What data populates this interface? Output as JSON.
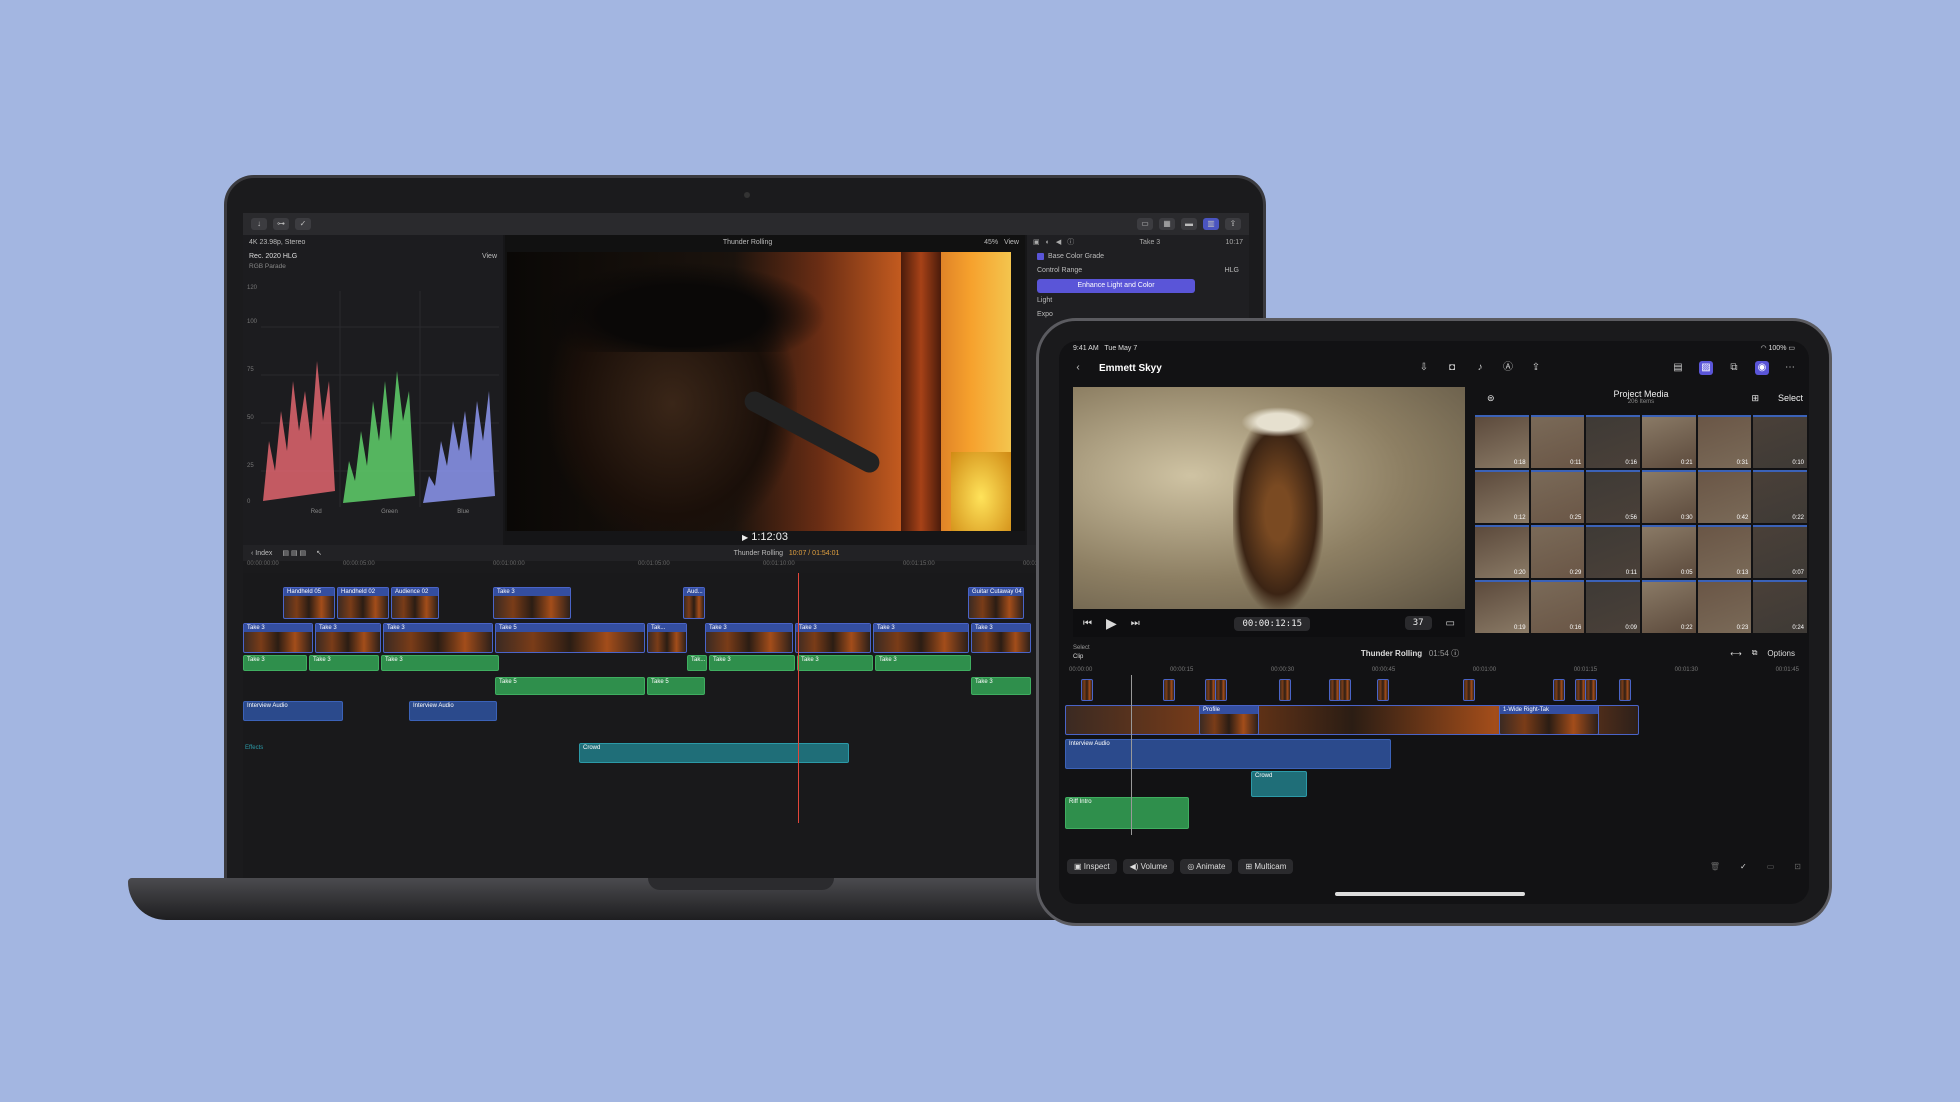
{
  "mac": {
    "format": "4K 23.98p, Stereo",
    "project_title": "Thunder Rolling",
    "zoom": "45%",
    "view_label": "View",
    "color_space": "Rec. 2020 HLG",
    "scope_view": "View",
    "scope_title": "RGB Parade",
    "scope_axis": [
      "120",
      "100",
      "75",
      "50",
      "25",
      "0"
    ],
    "scope_channels": [
      "Red",
      "Green",
      "Blue"
    ],
    "inspector_clip": "Take 3",
    "inspector_time": "10:17",
    "grade_label": "Base Color Grade",
    "control_range_label": "Control Range",
    "control_range_value": "HLG",
    "enhance_label": "Enhance Light and Color",
    "light_label": "Light",
    "expo_label": "Expo",
    "timecode": "1:12:03",
    "index_label": "Index",
    "timeline_title": "Thunder Rolling",
    "timeline_duration": "10:07 / 01:54:01",
    "ruler": [
      "00:00:00:00",
      "00:00:05:00",
      "00:01:00:00",
      "00:01:05:00",
      "00:01:10:00",
      "00:01:15:00",
      "00:01:20:0"
    ],
    "connected_clips": [
      {
        "label": "Handheld 05"
      },
      {
        "label": "Handheld 02"
      },
      {
        "label": "Audience 02"
      },
      {
        "label": "Take 3"
      },
      {
        "label": "Aud..."
      },
      {
        "label": "Guitar Cutaway 04"
      }
    ],
    "primary_clips": [
      "Take 3",
      "Take 3",
      "Take 3",
      "Take 5",
      "Tak...",
      "Take 3",
      "Take 3",
      "Take 3",
      "Take 3"
    ],
    "audio_clips_row1": [
      "Take 3",
      "Take 3",
      "Take 3",
      "Tak...",
      "Take 3",
      "Take 3",
      "Take 3"
    ],
    "audio_clips_row2": [
      "Take 5",
      "Take 5",
      "Take 3"
    ],
    "interview_clips": [
      "Interview Audio",
      "Interview Audio"
    ],
    "effects_label": "Effects",
    "crowd_label": "Crowd"
  },
  "ipad": {
    "time": "9:41 AM",
    "date": "Tue May 7",
    "battery": "100%",
    "project_name": "Emmett Skyy",
    "media_title": "Project Media",
    "media_count": "206 Items",
    "select_label": "Select",
    "timecode": "00:00:12:15",
    "zoom_value": "37",
    "select_small": "Select",
    "clip_label": "Clip",
    "timeline_title": "Thunder Rolling",
    "timeline_duration": "01:54",
    "options_label": "Options",
    "ruler": [
      "00:00:00",
      "00:00:15",
      "00:00:30",
      "00:00:45",
      "00:01:00",
      "00:01:15",
      "00:01:30",
      "00:01:45"
    ],
    "thumb_durations": [
      "0:18",
      "0:11",
      "0:16",
      "0:21",
      "0:31",
      "0:10",
      "0:12",
      "0:25",
      "0:56",
      "0:30",
      "0:42",
      "0:22",
      "0:20",
      "0:29",
      "0:11",
      "0:05",
      "0:13",
      "0:07",
      "0:19",
      "0:16",
      "0:09",
      "0:22",
      "0:23",
      "0:24"
    ],
    "profile_label": "Profile",
    "wide_label": "1-Wide Right-Tak",
    "interview_label": "Interview Audio",
    "crowd_label": "Crowd",
    "riff_label": "Riff Intro",
    "bottom_buttons": [
      "Inspect",
      "Volume",
      "Animate",
      "Multicam"
    ]
  }
}
